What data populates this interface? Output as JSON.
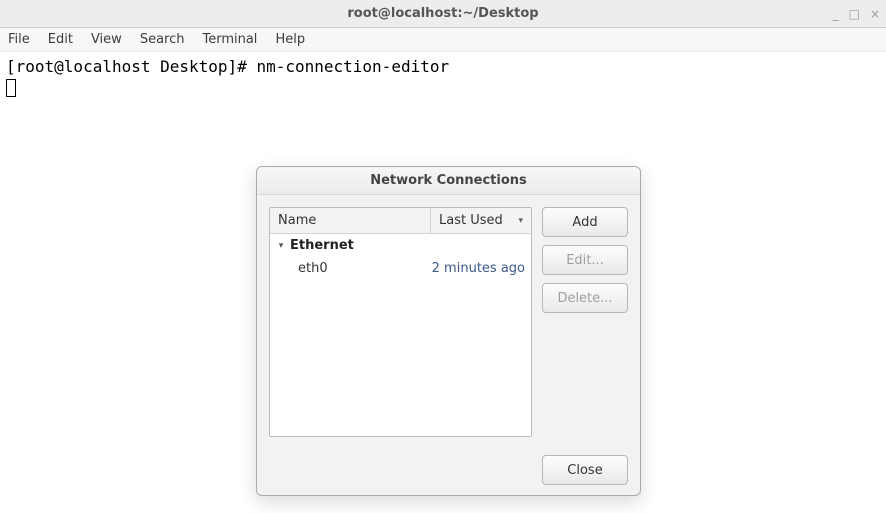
{
  "window": {
    "title": "root@localhost:~/Desktop",
    "controls": {
      "minimize": "_",
      "maximize": "□",
      "close": "×"
    }
  },
  "menubar": {
    "items": [
      "File",
      "Edit",
      "View",
      "Search",
      "Terminal",
      "Help"
    ]
  },
  "terminal": {
    "prompt": "[root@localhost Desktop]# ",
    "command": "nm-connection-editor"
  },
  "dialog": {
    "title": "Network Connections",
    "columns": {
      "name": "Name",
      "last_used": "Last Used"
    },
    "group": {
      "label": "Ethernet",
      "expanded": true
    },
    "items": [
      {
        "name": "eth0",
        "last_used": "2 minutes ago"
      }
    ],
    "buttons": {
      "add": "Add",
      "edit": "Edit...",
      "delete": "Delete...",
      "close": "Close"
    }
  }
}
